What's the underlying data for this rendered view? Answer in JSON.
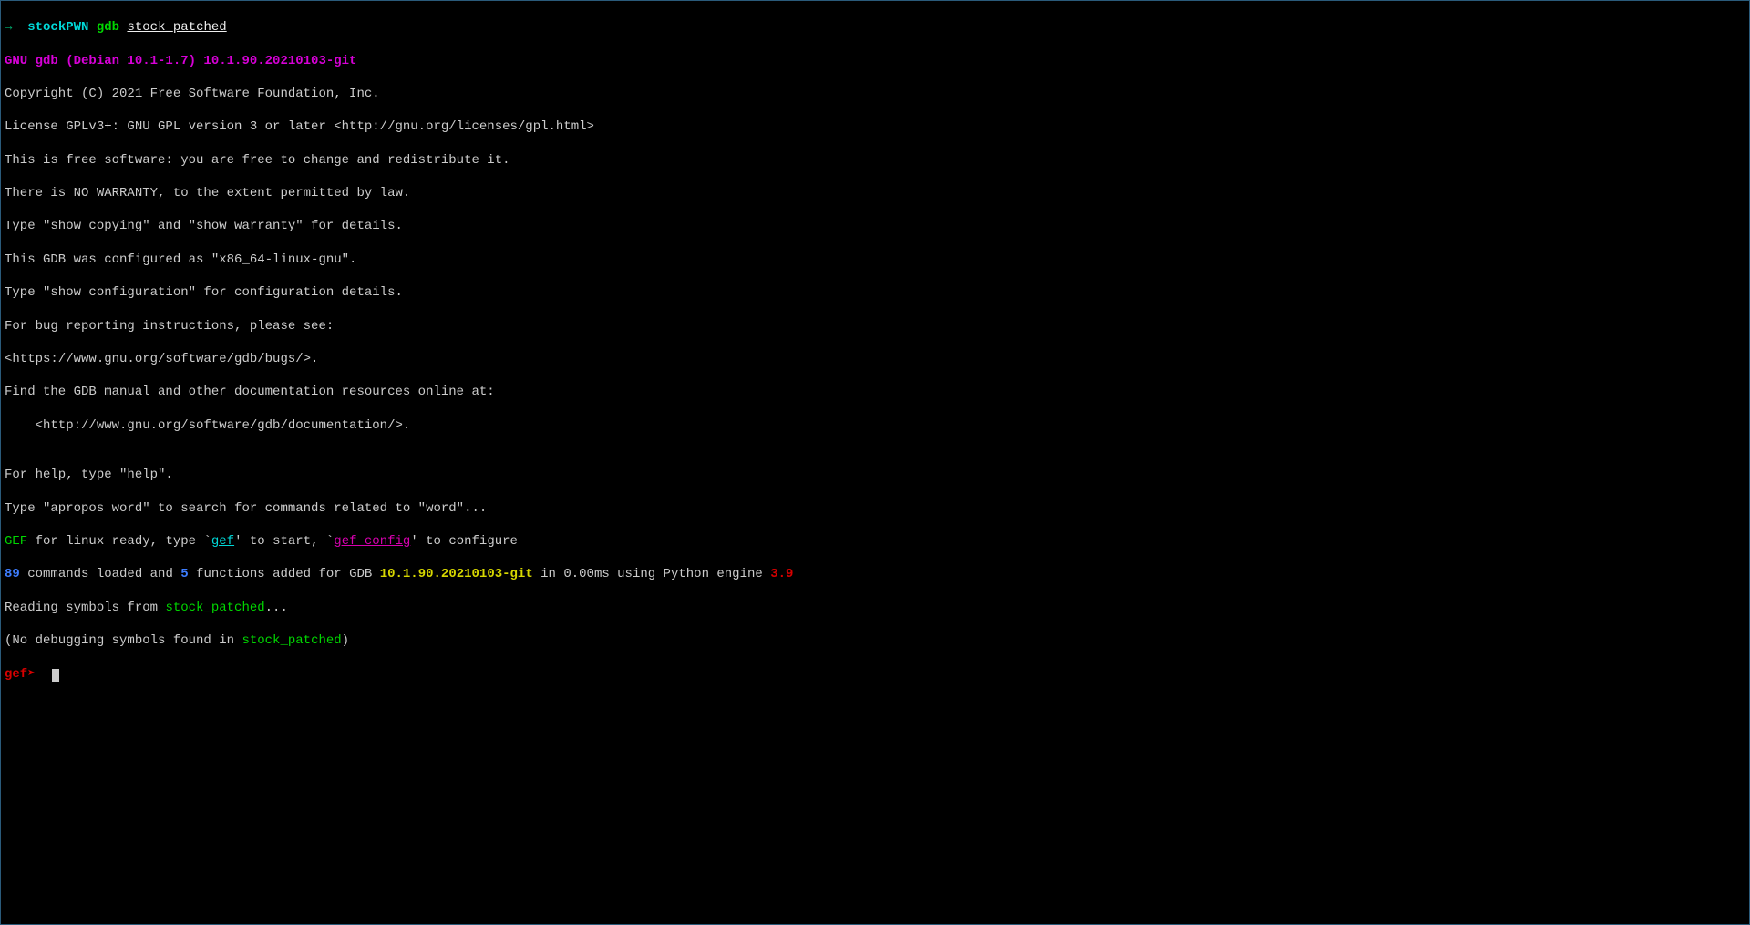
{
  "prompt": {
    "arrow": "→",
    "dir": "stockPWN",
    "cmd": "gdb",
    "arg": "stock_patched"
  },
  "banner": {
    "title": "GNU gdb (Debian 10.1-1.7) 10.1.90.20210103-git",
    "copyright": "Copyright (C) 2021 Free Software Foundation, Inc.",
    "license": "License GPLv3+: GNU GPL version 3 or later <http://gnu.org/licenses/gpl.html>",
    "free1": "This is free software: you are free to change and redistribute it.",
    "free2": "There is NO WARRANTY, to the extent permitted by law.",
    "show1": "Type \"show copying\" and \"show warranty\" for details.",
    "config1": "This GDB was configured as \"x86_64-linux-gnu\".",
    "config2": "Type \"show configuration\" for configuration details.",
    "bug1": "For bug reporting instructions, please see:",
    "bug2": "<https://www.gnu.org/software/gdb/bugs/>.",
    "doc1": "Find the GDB manual and other documentation resources online at:",
    "doc2": "    <http://www.gnu.org/software/gdb/documentation/>.",
    "blank": "",
    "help1": "For help, type \"help\".",
    "help2": "Type \"apropos word\" to search for commands related to \"word\"..."
  },
  "gef": {
    "label": "GEF",
    "ready_text": " for linux ready, type `",
    "gef_link": "gef",
    "start_text": "' to start, `",
    "config_link": "gef config",
    "tail": "' to configure"
  },
  "loaded": {
    "num_cmds": "89",
    "mid1": " commands loaded and ",
    "num_funcs": "5",
    "mid2": " functions added for GDB ",
    "version": "10.1.90.20210103-git",
    "mid3": " in 0.00ms using Python engine ",
    "py_ver": "3.9"
  },
  "reading": {
    "pre": "Reading symbols from ",
    "file": "stock_patched",
    "post": "..."
  },
  "nosym": {
    "pre": "(No debugging symbols found in ",
    "file": "stock_patched",
    "post": ")"
  },
  "gef_prompt": "gef➤"
}
